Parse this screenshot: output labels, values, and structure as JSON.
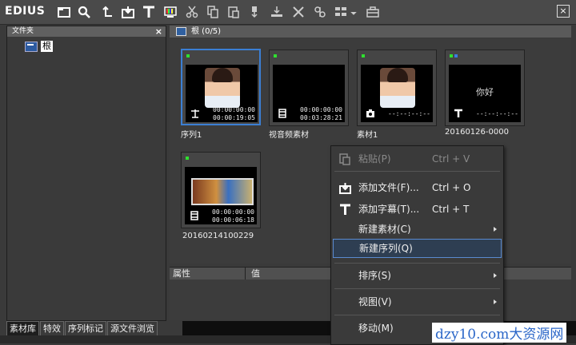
{
  "app": {
    "logo": "EDIUS"
  },
  "folder": {
    "title": "文件夹",
    "close": "×",
    "root_label": "根"
  },
  "bin": {
    "header": "根 (0/5)"
  },
  "clips": [
    {
      "name": "序列1",
      "tc1": "00:00:00:00",
      "tc2": "00:00:19:05",
      "type": "sequence-icon"
    },
    {
      "name": "视音频素材",
      "tc1": "00:00:00:00",
      "tc2": "00:03:28:21",
      "type": "film-icon"
    },
    {
      "name": "素材1",
      "tc1": "--:--:--:--",
      "tc2": "",
      "type": "camera-icon"
    },
    {
      "name": "20160126-0000",
      "tc1": "--:--:--:--",
      "tc2": "",
      "type": "title-icon",
      "overlay": "你好"
    },
    {
      "name": "20160214100229",
      "tc1": "00:00:00:00",
      "tc2": "00:00:06:18",
      "type": "film-icon"
    }
  ],
  "properties": {
    "col1": "属性",
    "col2": "值"
  },
  "tabs": [
    "素材库",
    "特效",
    "序列标记",
    "源文件浏览"
  ],
  "menu": {
    "items": [
      {
        "label": "粘贴(P)",
        "shortcut": "Ctrl + V",
        "disabled": true
      },
      {
        "label": "添加文件(F)...",
        "shortcut": "Ctrl + O"
      },
      {
        "label": "添加字幕(T)...",
        "shortcut": "Ctrl + T"
      },
      {
        "label": "新建素材(C)",
        "submenu": true
      },
      {
        "label": "新建序列(Q)",
        "highlighted": true
      },
      {
        "label": "排序(S)",
        "submenu": true
      },
      {
        "label": "视图(V)",
        "submenu": true
      },
      {
        "label": "移动(M)",
        "submenu": true
      }
    ]
  },
  "watermark": "dzy10.com大资源网",
  "colors": {
    "selection": "#3b7fd4",
    "menu_highlight": "#5a8ad0",
    "flag": "#2fe02f"
  }
}
